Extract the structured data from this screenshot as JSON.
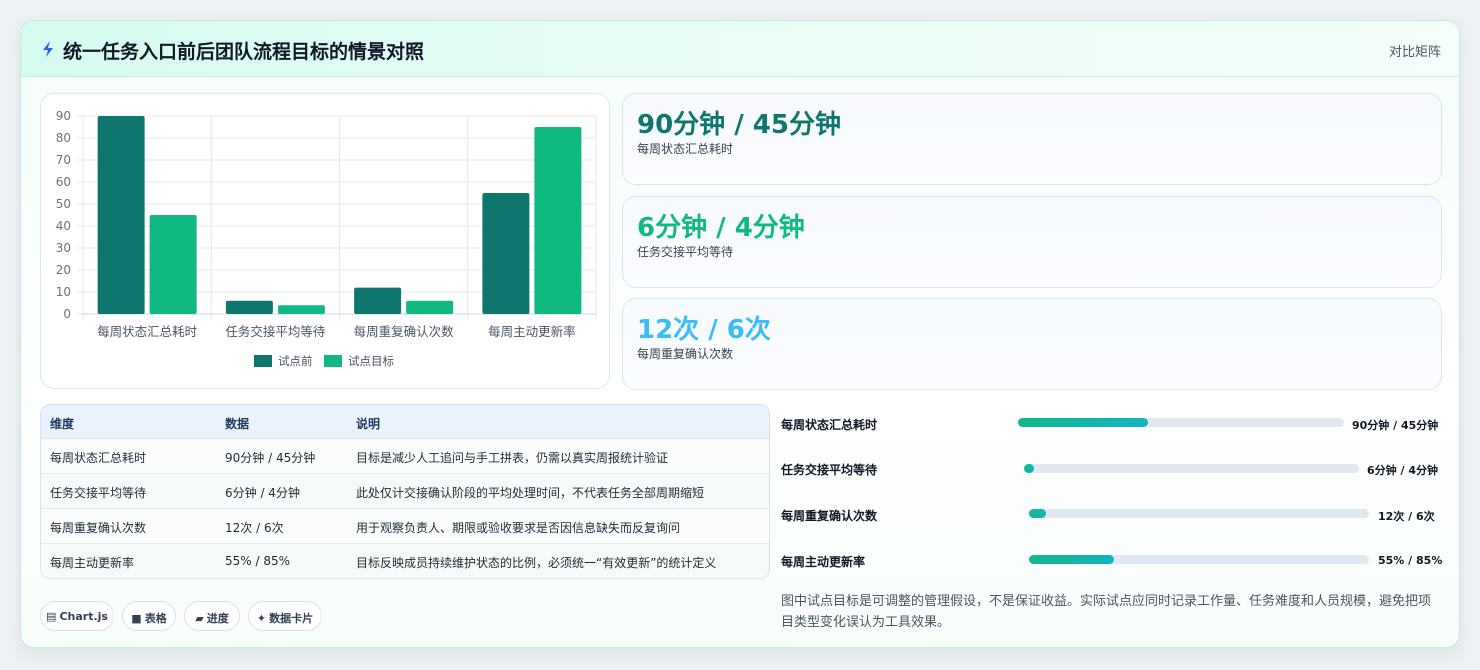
{
  "header": {
    "title": "统一任务入口前后团队流程目标的情景对照",
    "right_label": "对比矩阵",
    "icon": "lightning-icon"
  },
  "chart_data": {
    "type": "bar",
    "categories": [
      "每周状态汇总耗时",
      "任务交接平均等待",
      "每周重复确认次数",
      "每周主动更新率"
    ],
    "series": [
      {
        "name": "试点前",
        "values": [
          90,
          6,
          12,
          55
        ],
        "color": "#0f766e"
      },
      {
        "name": "试点目标",
        "values": [
          45,
          4,
          6,
          85
        ],
        "color": "#10b981"
      }
    ],
    "ylim": [
      0,
      90
    ],
    "yticks": [
      0,
      10,
      20,
      30,
      40,
      50,
      60,
      70,
      80,
      90
    ],
    "grid": true,
    "legend": "bottom"
  },
  "stats": [
    {
      "value": "90分钟 / 45分钟",
      "label": "每周状态汇总耗时",
      "color": "#0f766e"
    },
    {
      "value": "6分钟 / 4分钟",
      "label": "任务交接平均等待",
      "color": "#10b981"
    },
    {
      "value": "12次 / 6次",
      "label": "每周重复确认次数",
      "color": "#38bdf8"
    }
  ],
  "table": {
    "headers": [
      "维度",
      "数据",
      "说明"
    ],
    "rows": [
      [
        "每周状态汇总耗时",
        "90分钟 / 45分钟",
        "目标是减少人工追问与手工拼表，仍需以真实周报统计验证"
      ],
      [
        "任务交接平均等待",
        "6分钟 / 4分钟",
        "此处仅计交接确认阶段的平均处理时间，不代表任务全部周期缩短"
      ],
      [
        "每周重复确认次数",
        "12次 / 6次",
        "用于观察负责人、期限或验收要求是否因信息缺失而反复询问"
      ],
      [
        "每周主动更新率",
        "55% / 85%",
        "目标反映成员持续维护状态的比例，必须统一“有效更新”的统计定义"
      ]
    ]
  },
  "chips": [
    {
      "icon": "▤",
      "label": "Chart.js",
      "icon_name": "chart-icon"
    },
    {
      "icon": "■",
      "label": "表格",
      "icon_name": "table-icon"
    },
    {
      "icon": "▰",
      "label": "进度",
      "icon_name": "progress-icon"
    },
    {
      "icon": "✦",
      "label": "数据卡片",
      "icon_name": "sparkle-icon"
    }
  ],
  "progress": [
    {
      "label": "每周状态汇总耗时",
      "value_text": "90分钟 / 45分钟",
      "fraction": 0.4
    },
    {
      "label": "任务交接平均等待",
      "value_text": "6分钟 / 4分钟",
      "fraction": 0.03
    },
    {
      "label": "每周重复确认次数",
      "value_text": "12次 / 6次",
      "fraction": 0.05
    },
    {
      "label": "每周主动更新率",
      "value_text": "55% / 85%",
      "fraction": 0.25
    }
  ],
  "note": "图中试点目标是可调整的管理假设，不是保证收益。实际试点应同时记录工作量、任务难度和人员规模，避免把项目类型变化误认为工具效果。"
}
